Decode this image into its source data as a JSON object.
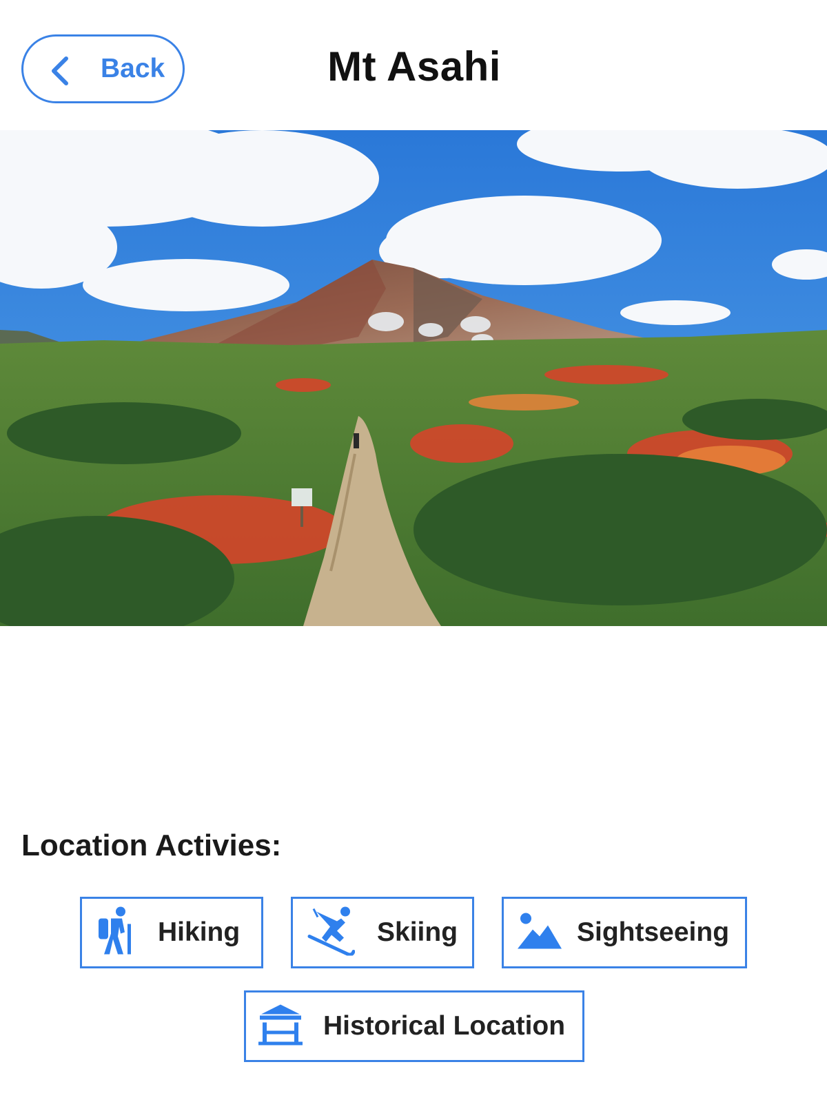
{
  "header": {
    "back_label": "Back",
    "title": "Mt Asahi"
  },
  "colors": {
    "accent": "#3a82e6",
    "icon_blue": "#2f80ed"
  },
  "activities": {
    "heading": "Location Activies:",
    "items": [
      {
        "label": "Hiking",
        "icon": "hiking-icon"
      },
      {
        "label": "Skiing",
        "icon": "skiing-icon"
      },
      {
        "label": "Sightseeing",
        "icon": "mountain-icon"
      },
      {
        "label": "Historical Location",
        "icon": "temple-icon"
      }
    ]
  }
}
